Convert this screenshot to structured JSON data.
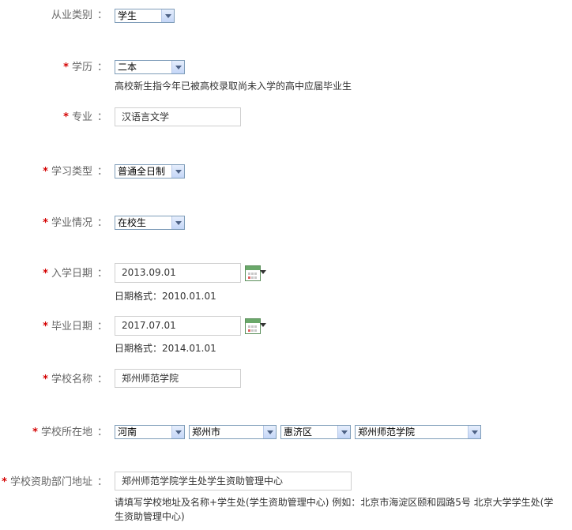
{
  "form": {
    "occupation": {
      "label": "从业类别",
      "required": false,
      "value": "学生"
    },
    "education": {
      "label": "学历",
      "required": true,
      "value": "二本",
      "hint": "高校新生指今年已被高校录取尚未入学的高中应届毕业生"
    },
    "major": {
      "label": "专业",
      "required": true,
      "value": "汉语言文学"
    },
    "study_type": {
      "label": "学习类型",
      "required": true,
      "value": "普通全日制"
    },
    "study_status": {
      "label": "学业情况",
      "required": true,
      "value": "在校生"
    },
    "enroll_date": {
      "label": "入学日期",
      "required": true,
      "value": "2013.09.01",
      "hint": "日期格式：2010.01.01"
    },
    "graduation_date": {
      "label": "毕业日期",
      "required": true,
      "value": "2017.07.01",
      "hint": "日期格式：2014.01.01"
    },
    "school_name": {
      "label": "学校名称",
      "required": true,
      "value": "郑州师范学院"
    },
    "school_location": {
      "label": "学校所在地",
      "required": true,
      "province": "河南",
      "city": "郑州市",
      "district": "惠济区",
      "school": "郑州师范学院"
    },
    "aid_address": {
      "label": "学校资助部门地址",
      "required": true,
      "value": "郑州师范学院学生处学生资助管理中心",
      "hint_line1": "请填写学校地址及名称+学生处(学生资助管理中心) 例如：北京市海淀区颐和园路5号 北京大学学生处(学",
      "hint_line2": "生资助管理中心)"
    }
  },
  "ui": {
    "star": "*",
    "colon": "："
  }
}
